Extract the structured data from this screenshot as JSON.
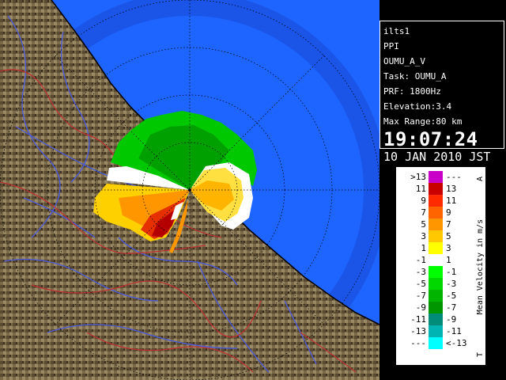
{
  "info": {
    "lines": [
      "ilts1",
      "PPI",
      "OUMU_A_V",
      "Task: OUMU_A",
      "PRF: 1800Hz",
      "Elevation:3.4",
      "Max Range:80 km"
    ],
    "time": "19:07:24",
    "date": "10 JAN 2010 JST"
  },
  "legend": {
    "title": "Mean Velocity in m/s",
    "top_mark": "A",
    "bottom_mark": "T",
    "rows": [
      {
        "left": ">13",
        "right": "---",
        "color": "#c800c8"
      },
      {
        "left": "11",
        "right": "13",
        "color": "#c80000"
      },
      {
        "left": "9",
        "right": "11",
        "color": "#ff2a00"
      },
      {
        "left": "7",
        "right": "9",
        "color": "#ff6400"
      },
      {
        "left": "5",
        "right": "7",
        "color": "#ff9600"
      },
      {
        "left": "3",
        "right": "5",
        "color": "#ffc800"
      },
      {
        "left": "1",
        "right": "3",
        "color": "#ffff00"
      },
      {
        "left": "-1",
        "right": "1",
        "color": "#ffffff"
      },
      {
        "left": "-3",
        "right": "-1",
        "color": "#00ff00"
      },
      {
        "left": "-5",
        "right": "-3",
        "color": "#00d800"
      },
      {
        "left": "-7",
        "right": "-5",
        "color": "#00b400"
      },
      {
        "left": "-9",
        "right": "-7",
        "color": "#009600"
      },
      {
        "left": "-11",
        "right": "-9",
        "color": "#008c78"
      },
      {
        "left": "-13",
        "right": "-11",
        "color": "#00b4b4"
      },
      {
        "left": "---",
        "right": "<-13",
        "color": "#00ffff"
      }
    ]
  },
  "map": {
    "sea_color": "#1e64ff",
    "range_band_color": "#1450dc",
    "land_color": "#7a6a4a",
    "river_color": "#4a5adc",
    "border_color": "#b43232",
    "coast_color": "#000000",
    "ring_color": "#000000",
    "range_ring_count": 4
  }
}
